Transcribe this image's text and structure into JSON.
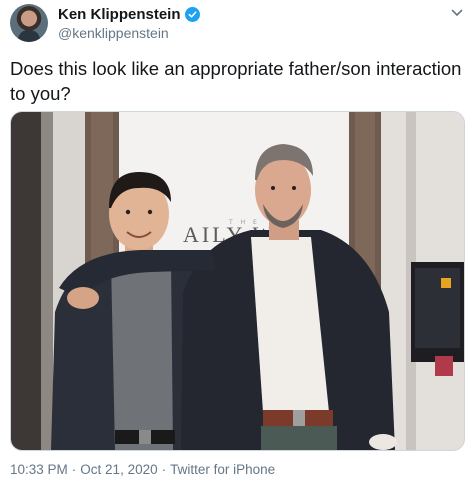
{
  "user": {
    "display_name": "Ken Klippenstein",
    "handle": "@kenklippenstein",
    "avatar_icon": "user-avatar",
    "verified_icon": "verified-badge-icon",
    "verified_color": "#1da1f2"
  },
  "menu": {
    "icon": "chevron-down-icon"
  },
  "tweet": {
    "text": "Does this look like an appropriate father/son interaction to you?"
  },
  "media": {
    "sign_text": "AILY W",
    "sign_small_text": "T H E"
  },
  "meta": {
    "time": "10:33 PM",
    "separator": "·",
    "date": "Oct 21, 2020",
    "source": "Twitter for iPhone"
  },
  "colors": {
    "text_primary": "#14171a",
    "text_secondary": "#657786",
    "border": "#ccd6dd"
  }
}
